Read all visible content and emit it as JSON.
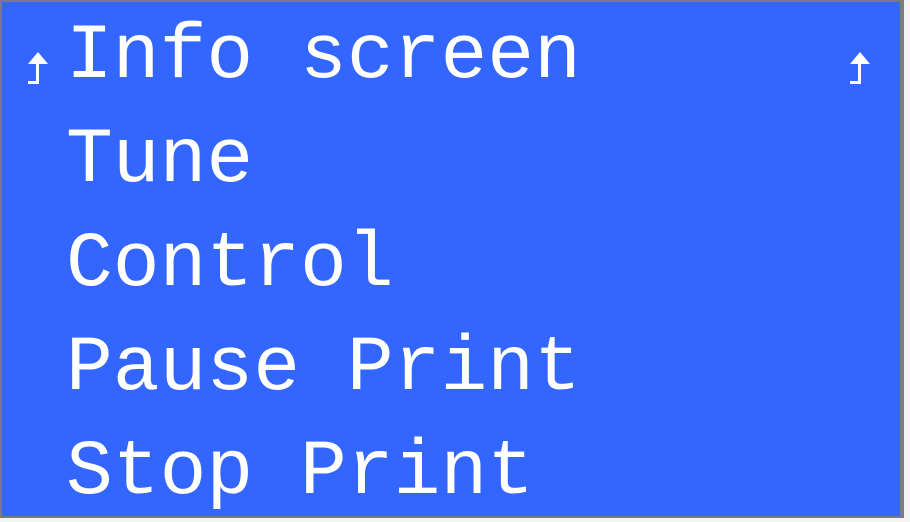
{
  "menu": {
    "items": [
      {
        "label": "Info screen",
        "icon": "back-arrow-icon",
        "selected": true
      },
      {
        "label": "Tune"
      },
      {
        "label": "Control"
      },
      {
        "label": "Pause Print"
      },
      {
        "label": "Stop Print"
      }
    ],
    "scroll_indicator_icon": "up-arrow-icon"
  },
  "colors": {
    "background": "#3366ff",
    "text": "#ffffff",
    "frame": "#7a7a86"
  }
}
